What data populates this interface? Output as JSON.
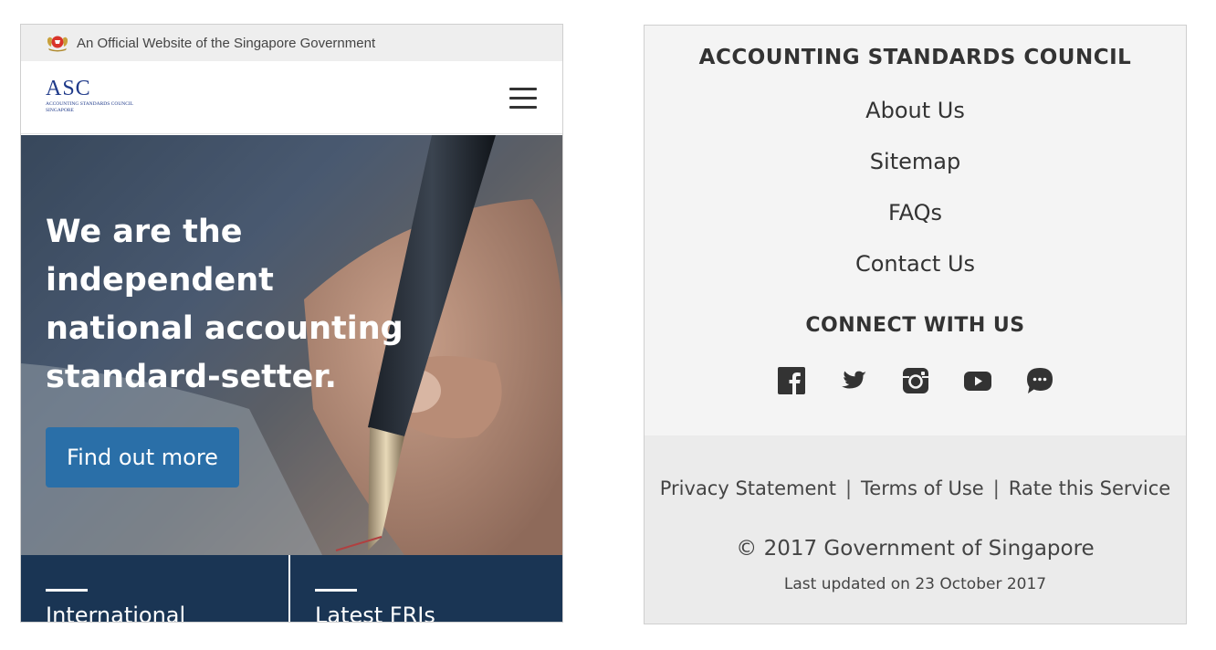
{
  "gov_bar": {
    "text": "An Official Website of the Singapore Government",
    "crest_icon": "singapore-crest-icon"
  },
  "header": {
    "logo_mark": "ASC",
    "logo_sub": "ACCOUNTING STANDARDS COUNCIL\nSINGAPORE",
    "menu_icon": "hamburger-menu-icon"
  },
  "hero": {
    "title": "We are the independent national accounting standard-setter.",
    "button_label": "Find out more"
  },
  "tiles": [
    {
      "title": "International"
    },
    {
      "title": "Latest FRIs"
    }
  ],
  "footer": {
    "heading": "ACCOUNTING STANDARDS COUNCIL",
    "links": [
      "About Us",
      "Sitemap",
      "FAQs",
      "Contact Us"
    ],
    "connect_heading": "CONNECT WITH US",
    "socials": [
      "facebook-icon",
      "twitter-icon",
      "instagram-icon",
      "youtube-icon",
      "chat-icon"
    ],
    "legal": {
      "privacy": "Privacy Statement",
      "terms": "Terms of Use",
      "rate": "Rate this Service",
      "separator": "|"
    },
    "copyright": "© 2017 Government of Singapore",
    "updated": "Last updated on 23 October 2017"
  },
  "colors": {
    "brand_blue": "#1f3a8a",
    "button_blue": "#2a6fa8",
    "tile_navy": "#1a3554",
    "footer_bg": "#f4f4f4",
    "footer_bottom_bg": "#ebebeb"
  }
}
